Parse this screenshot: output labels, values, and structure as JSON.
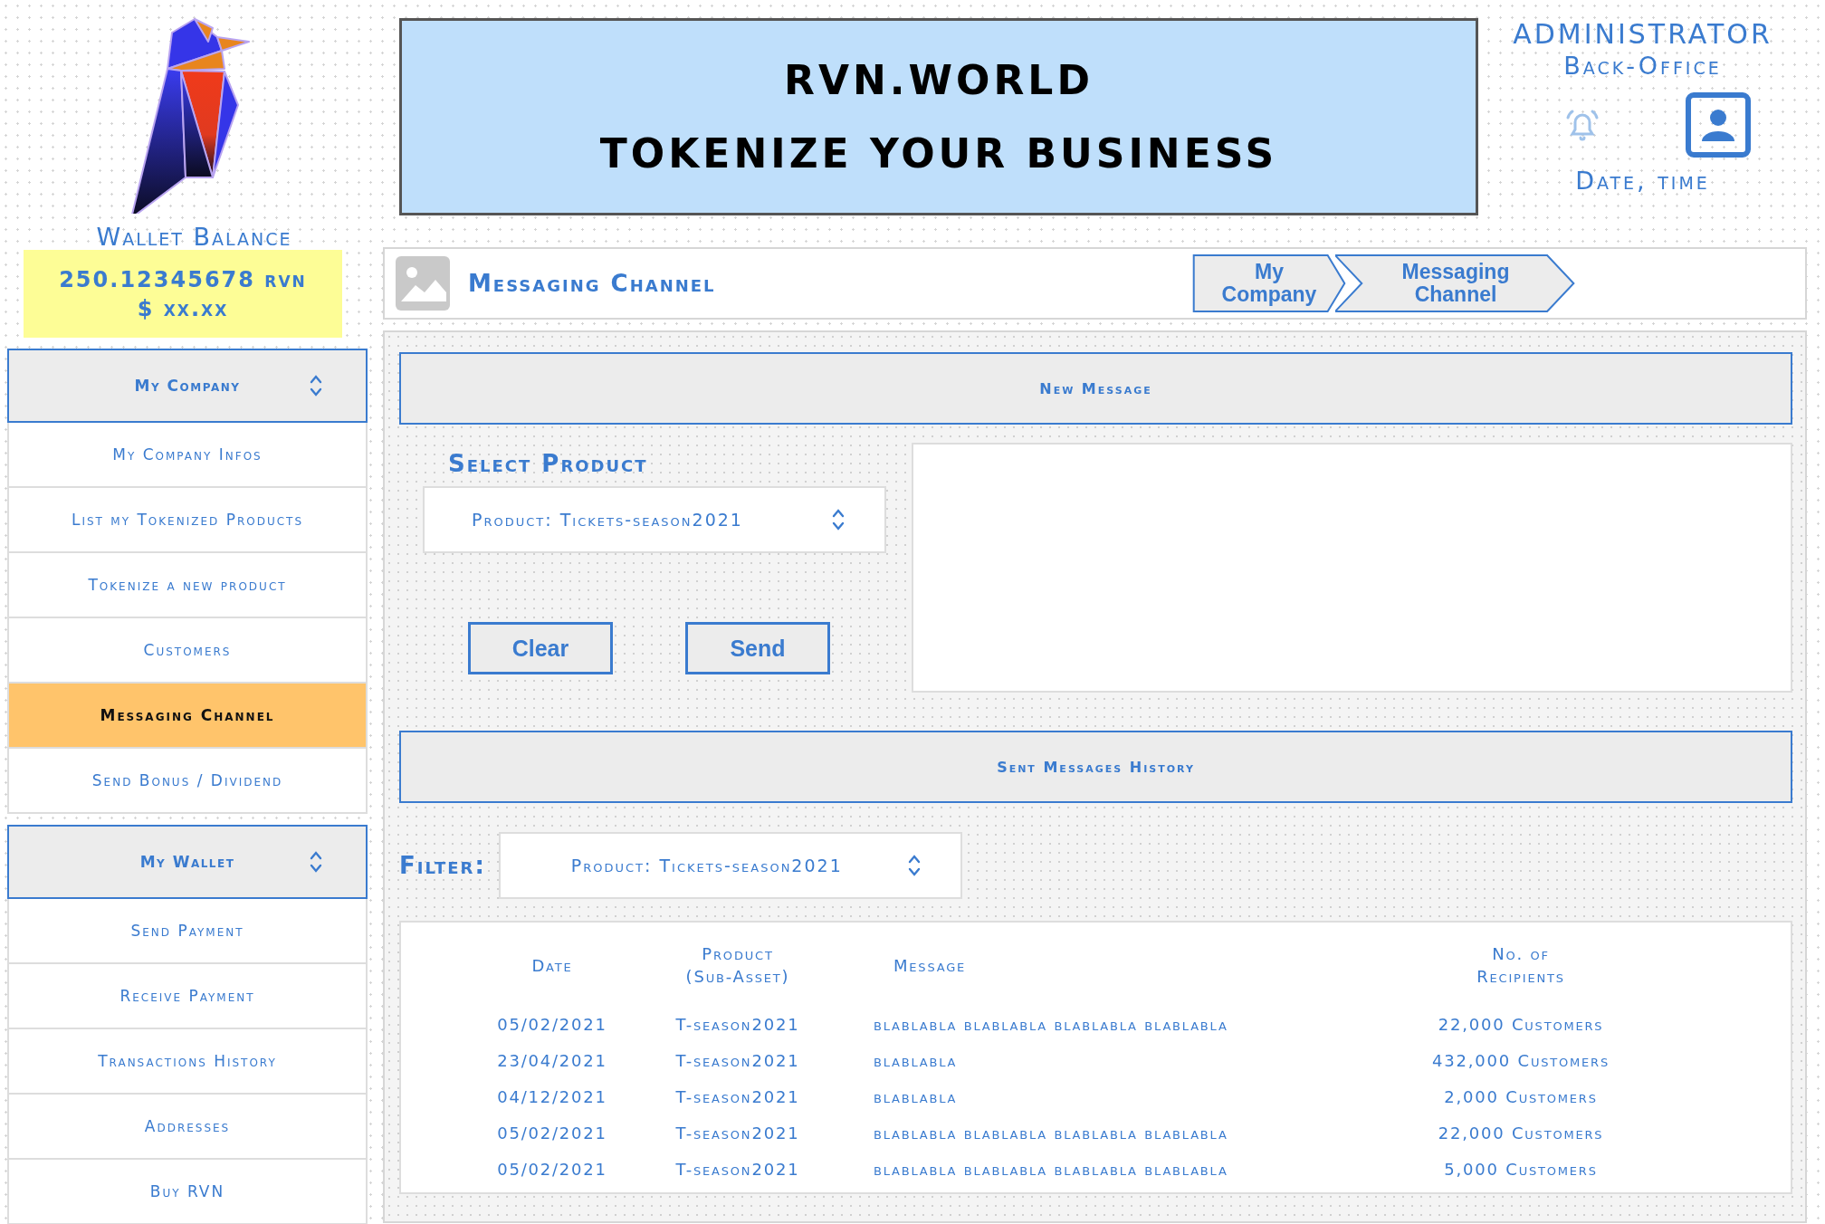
{
  "wallet": {
    "title": "Wallet Balance",
    "amount": "250.12345678 rvn",
    "fiat": "$ xx.xx"
  },
  "sidebar": {
    "groups": [
      {
        "label": "My Company",
        "items": [
          {
            "label": "My Company Infos",
            "selected": false
          },
          {
            "label": "List my Tokenized Products",
            "selected": false
          },
          {
            "label": "Tokenize a new product",
            "selected": false
          },
          {
            "label": "Customers",
            "selected": false
          },
          {
            "label": "Messaging Channel",
            "selected": true
          },
          {
            "label": "Send Bonus / Dividend",
            "selected": false
          }
        ]
      },
      {
        "label": "My Wallet",
        "items": [
          {
            "label": "Send Payment",
            "selected": false
          },
          {
            "label": "Receive Payment",
            "selected": false
          },
          {
            "label": "Transactions History",
            "selected": false
          },
          {
            "label": "Addresses",
            "selected": false
          },
          {
            "label": "Buy RVN",
            "selected": false
          }
        ]
      }
    ]
  },
  "banner": {
    "lines": [
      "RVN.WORLD",
      "TOKENIZE YOUR BUSINESS"
    ]
  },
  "account": {
    "role": "ADMINISTRATOR",
    "area": "Back-Office",
    "datetime": "Date, time"
  },
  "page_header": {
    "title": "Messaging Channel",
    "breadcrumb": [
      "My\nCompany",
      "Messaging\nChannel"
    ]
  },
  "new_message": {
    "title": "New Message",
    "select_label": "Select Product",
    "product_select": "Product: Tickets-season2021",
    "buttons": [
      "Clear",
      "Send"
    ]
  },
  "history": {
    "title": "Sent Messages History",
    "filter_label": "Filter:",
    "filter_select": "Product: Tickets-season2021",
    "columns": [
      "Date",
      "Product\n(Sub-Asset)",
      "Message",
      "No. of\nRecipients"
    ],
    "rows": [
      [
        "05/02/2021",
        "T-season2021",
        "blablabla blablabla blablabla blablabla",
        "22,000 Customers"
      ],
      [
        "23/04/2021",
        "T-season2021",
        "blablabla",
        "432,000 Customers"
      ],
      [
        "04/12/2021",
        "T-season2021",
        "blablabla",
        "2,000 Customers"
      ],
      [
        "05/02/2021",
        "T-season2021",
        "blablabla blablabla blablabla blablabla",
        "22,000 Customers"
      ],
      [
        "05/02/2021",
        "T-season2021",
        "blablabla blablabla blablabla blablabla",
        "5,000 Customers"
      ]
    ]
  }
}
